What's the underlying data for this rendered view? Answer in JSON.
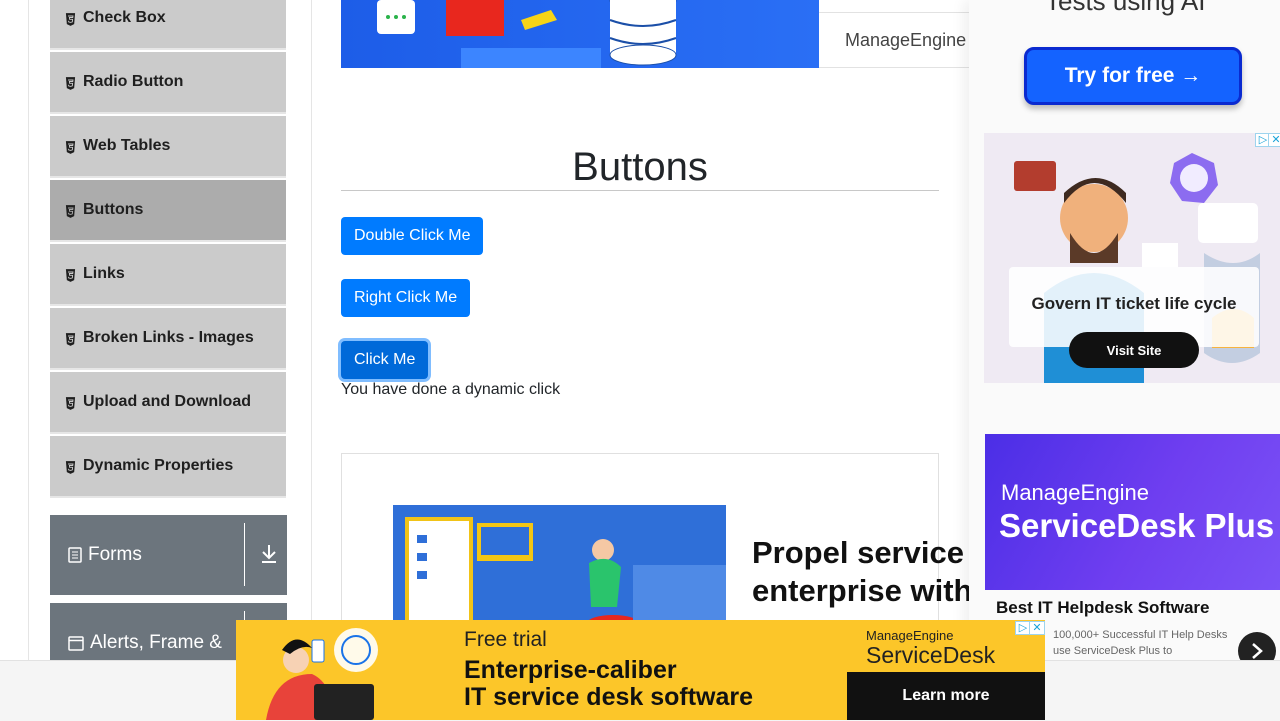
{
  "sidebar": {
    "items": [
      {
        "label": "Check Box"
      },
      {
        "label": "Radio Button"
      },
      {
        "label": "Web Tables"
      },
      {
        "label": "Buttons"
      },
      {
        "label": "Links"
      },
      {
        "label": "Broken Links - Images"
      },
      {
        "label": "Upload and Download"
      },
      {
        "label": "Dynamic Properties"
      }
    ],
    "active_item": "Buttons",
    "groups": [
      {
        "label": "Forms"
      },
      {
        "label": "Alerts, Frame &"
      }
    ]
  },
  "top_banner": {
    "tab_label": "ManageEngine"
  },
  "main": {
    "title": "Buttons",
    "buttons": {
      "double_click": "Double Click Me",
      "right_click": "Right Click Me",
      "click": "Click Me"
    },
    "dynamic_click_message": "You have done a dynamic click",
    "ad_card": {
      "headline_line1": "Propel service o",
      "headline_line2": "enterprise with"
    }
  },
  "right_ads": {
    "ai_fragment": "Tests using AI",
    "try_button": "Try for free →",
    "square_ad": {
      "headline": "Govern IT ticket life cycle",
      "cta": "Visit Site",
      "brand_badge": "ManageEngine ServiceDesk Plus"
    },
    "sd_ad": {
      "brand": "ManageEngine",
      "product": "ServiceDesk Plus",
      "title": "Best IT Helpdesk Software",
      "desc": "100,000+ Successful IT Help Desks use ServiceDesk Plus to"
    }
  },
  "bottom_ad": {
    "small": "Free trial",
    "line1": "Enterprise-caliber",
    "line2": "IT service desk software",
    "brand": "ManageEngine",
    "product": "ServiceDesk Plus",
    "cta": "Learn more"
  },
  "colors": {
    "primary": "#007bff",
    "sidebar_item": "#cbcbcb",
    "sidebar_active": "#acacac",
    "group_header": "#6c757d",
    "ad_yellow": "#fcc629"
  },
  "icons": [
    "html5-icon",
    "download-icon",
    "form-icon",
    "window-icon",
    "chevron-right-icon",
    "ad-choices-icon",
    "close-icon"
  ]
}
